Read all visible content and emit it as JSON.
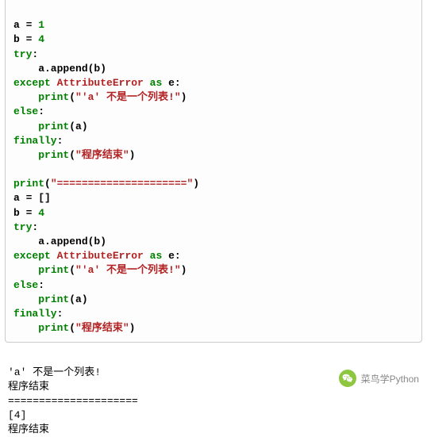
{
  "code": {
    "l01_a": "a = ",
    "l01_n": "1",
    "l02_a": "b = ",
    "l02_n": "4",
    "l03_try": "try",
    "l03_colon": ":",
    "l04_body": "    a.append(b)",
    "l05_except": "except",
    "l05_sp1": " ",
    "l05_err": "AttributeError",
    "l05_sp2": " ",
    "l05_as": "as",
    "l05_sp3": " e:",
    "l06_ind": "    ",
    "l06_print": "print",
    "l06_open": "(",
    "l06_str": "\"'a' 不是一个列表!\"",
    "l06_close": ")",
    "l07_else": "else",
    "l07_colon": ":",
    "l08_ind": "    ",
    "l08_print": "print",
    "l08_args": "(a)",
    "l09_finally": "finally",
    "l09_colon": ":",
    "l10_ind": "    ",
    "l10_print": "print",
    "l10_open": "(",
    "l10_str": "\"程序结束\"",
    "l10_close": ")",
    "blank": "",
    "sep_print": "print",
    "sep_open": "(",
    "sep_str": "\"=====================\"",
    "sep_close": ")",
    "l11_a": "a = []",
    "l12_a": "b = ",
    "l12_n": "4"
  },
  "output": {
    "l1": "'a' 不是一个列表!",
    "l2": "程序结束",
    "l3": "=====================",
    "l4": "[4]",
    "l5": "程序结束"
  },
  "watermark": {
    "text": "菜鸟学Python"
  }
}
